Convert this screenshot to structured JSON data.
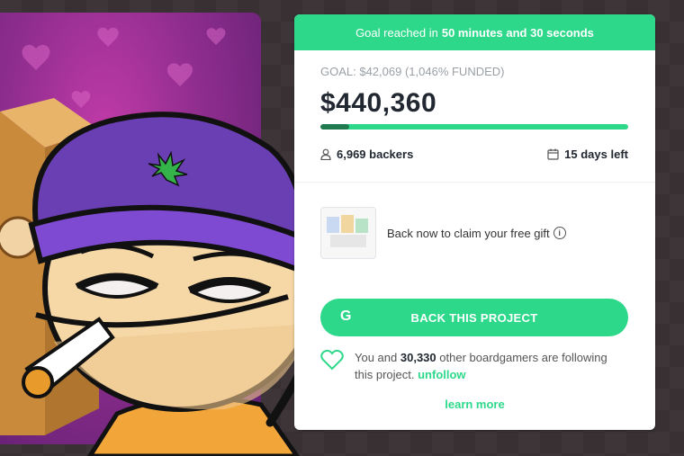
{
  "banner": {
    "prefix": "Goal reached in",
    "time": "50 minutes and 30 seconds"
  },
  "funding": {
    "goal_line": "GOAL: $42,069 (1,046% FUNDED)",
    "amount": "$440,360",
    "progress_percent": 100
  },
  "stats": {
    "backers": "6,969 backers",
    "days_left": "15 days left"
  },
  "gift": {
    "text": "Back now to claim your free gift",
    "info_icon": "i"
  },
  "cta": {
    "label": "BACK THIS PROJECT",
    "logo": "G"
  },
  "follow": {
    "prefix": "You and",
    "count": "30,330",
    "suffix": "other boardgamers are following this project.",
    "unfollow": "unfollow"
  },
  "learn_more": "learn more",
  "colors": {
    "accent": "#2ed88a",
    "dark_text": "#222831",
    "muted_text": "#9aa0a6"
  },
  "icons": [
    "user-icon",
    "calendar-icon",
    "info-icon",
    "heart-icon"
  ]
}
